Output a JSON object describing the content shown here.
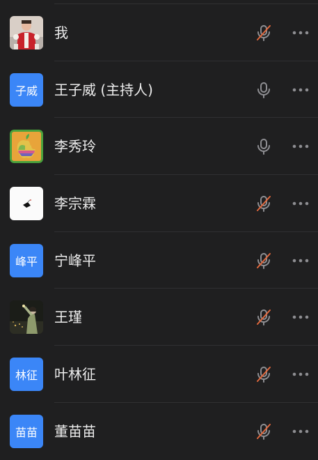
{
  "participants": [
    {
      "name": "我",
      "avatar_type": "photo-red-costume",
      "muted": true
    },
    {
      "name": "王子威 (主持人)",
      "avatar_type": "text",
      "avatar_text": "子威",
      "muted": false
    },
    {
      "name": "李秀玲",
      "avatar_type": "photo-apple-logo",
      "muted": false
    },
    {
      "name": "李宗霖",
      "avatar_type": "photo-white-minimal",
      "muted": true
    },
    {
      "name": "宁峰平",
      "avatar_type": "text",
      "avatar_text": "峰平",
      "muted": true
    },
    {
      "name": "王瑾",
      "avatar_type": "photo-night-figure",
      "muted": true
    },
    {
      "name": "叶林征",
      "avatar_type": "text",
      "avatar_text": "林征",
      "muted": true
    },
    {
      "name": "董苗苗",
      "avatar_type": "text",
      "avatar_text": "苗苗",
      "muted": true
    }
  ],
  "icons": {
    "mic_active": "microphone-icon",
    "mic_muted": "microphone-muted-icon",
    "more": "more-options-icon"
  },
  "colors": {
    "background": "#1f1f20",
    "divider": "#303032",
    "text_avatar": "#3b86f7",
    "muted_slash": "#e0673c",
    "icon_gray": "#8e8e92"
  }
}
